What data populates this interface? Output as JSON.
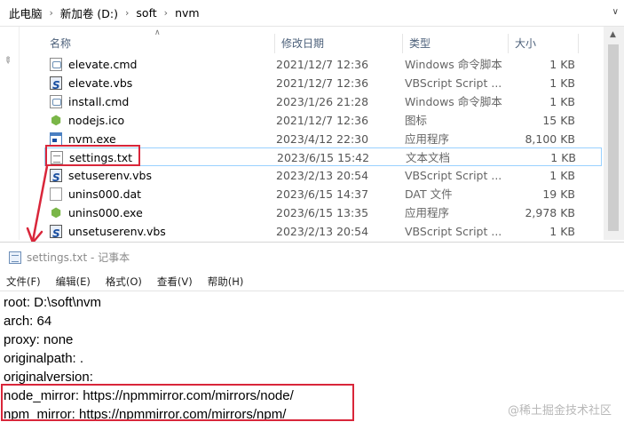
{
  "breadcrumb": {
    "items": [
      "此电脑",
      "新加卷 (D:)",
      "soft",
      "nvm"
    ]
  },
  "columns": {
    "name": "名称",
    "date": "修改日期",
    "type": "类型",
    "size": "大小"
  },
  "files": [
    {
      "name": "elevate.cmd",
      "date": "2021/12/7 12:36",
      "type": "Windows 命令脚本",
      "size": "1 KB",
      "icon": "cmd-file-icon"
    },
    {
      "name": "elevate.vbs",
      "date": "2021/12/7 12:36",
      "type": "VBScript Script ...",
      "size": "1 KB",
      "icon": "vbs-file-icon"
    },
    {
      "name": "install.cmd",
      "date": "2023/1/26 21:28",
      "type": "Windows 命令脚本",
      "size": "1 KB",
      "icon": "cmd-file-icon"
    },
    {
      "name": "nodejs.ico",
      "date": "2021/12/7 12:36",
      "type": "图标",
      "size": "15 KB",
      "icon": "nodejs-icon-file-icon"
    },
    {
      "name": "nvm.exe",
      "date": "2023/4/12 22:30",
      "type": "应用程序",
      "size": "8,100 KB",
      "icon": "exe-file-icon"
    },
    {
      "name": "settings.txt",
      "date": "2023/6/15 15:42",
      "type": "文本文档",
      "size": "1 KB",
      "icon": "txt-file-icon"
    },
    {
      "name": "setuserenv.vbs",
      "date": "2023/2/13 20:54",
      "type": "VBScript Script ...",
      "size": "1 KB",
      "icon": "vbs-file-icon"
    },
    {
      "name": "unins000.dat",
      "date": "2023/6/15 14:37",
      "type": "DAT 文件",
      "size": "19 KB",
      "icon": "dat-file-icon"
    },
    {
      "name": "unins000.exe",
      "date": "2023/6/15 13:35",
      "type": "应用程序",
      "size": "2,978 KB",
      "icon": "installer-exe-icon"
    },
    {
      "name": "unsetuserenv.vbs",
      "date": "2023/2/13 20:54",
      "type": "VBScript Script ...",
      "size": "1 KB",
      "icon": "vbs-file-icon"
    }
  ],
  "notepad": {
    "title": "settings.txt - 记事本",
    "menu": [
      "文件(F)",
      "编辑(E)",
      "格式(O)",
      "查看(V)",
      "帮助(H)"
    ],
    "lines": [
      "root: D:\\soft\\nvm",
      "arch: 64",
      "proxy: none",
      "originalpath: .",
      "originalversion:",
      "node_mirror: https://npmmirror.com/mirrors/node/",
      "npm_mirror: https://npmmirror.com/mirrors/npm/"
    ]
  },
  "watermark": "@稀土掘金技术社区",
  "colors": {
    "highlight": "#d9263a",
    "selection_border": "#99d1ff"
  }
}
